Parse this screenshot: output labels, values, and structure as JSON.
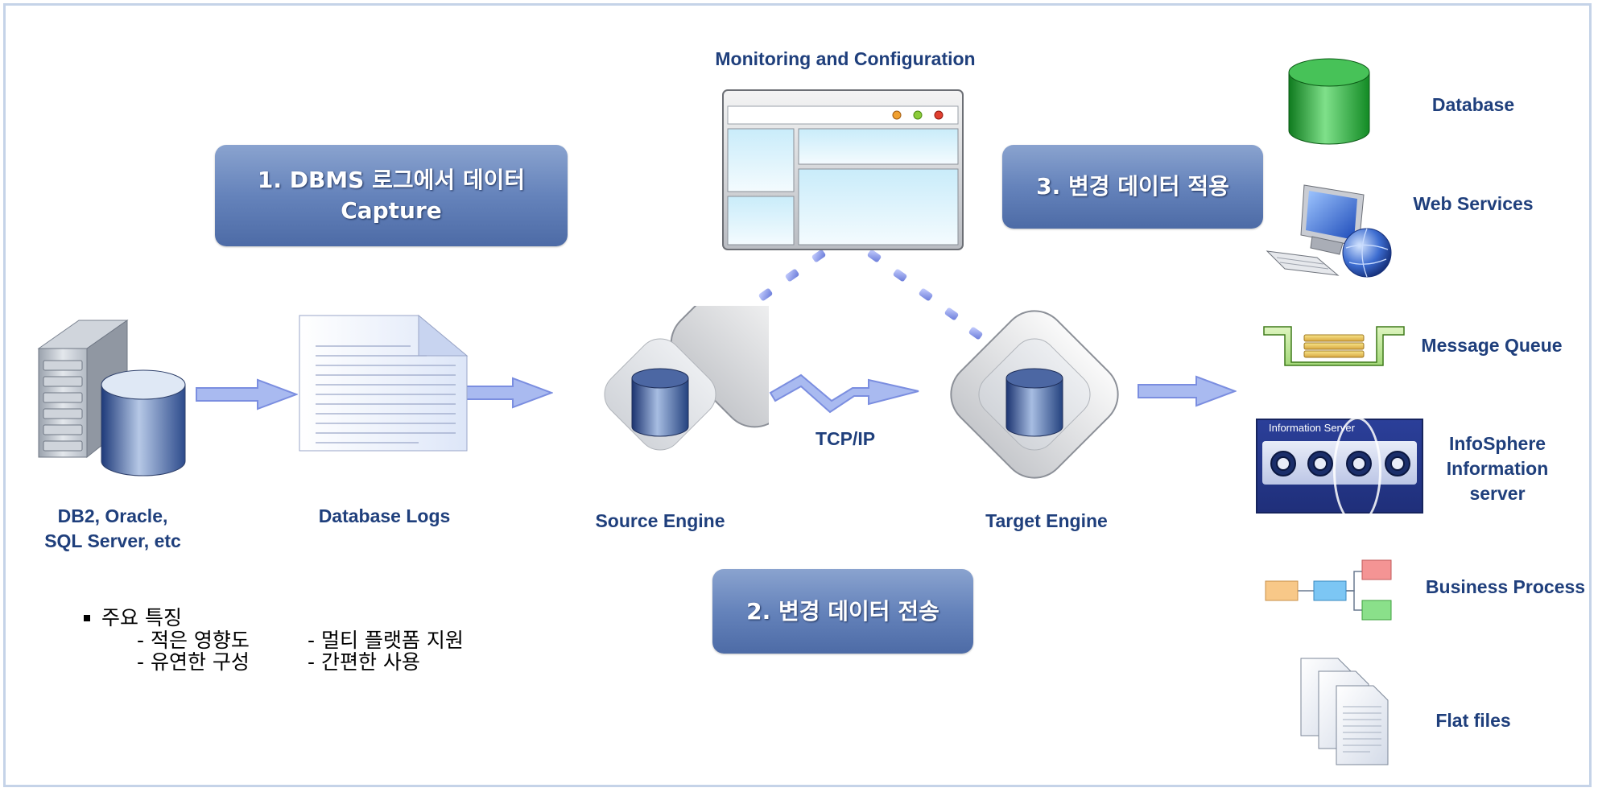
{
  "callouts": {
    "capture": "1. DBMS 로그에서 데이터\nCapture",
    "transfer": "2. 변경 데이터 전송",
    "apply": "3. 변경 데이터 적용"
  },
  "labels": {
    "monitoring": "Monitoring and Configuration",
    "sources": "DB2, Oracle,\nSQL Server, etc",
    "database_logs": "Database Logs",
    "source_engine": "Source Engine",
    "target_engine": "Target Engine",
    "tcpip": "TCP/IP",
    "info_server_panel": "Information Server"
  },
  "targets": [
    {
      "label": "Database",
      "icon": "database-icon"
    },
    {
      "label": "Web Services",
      "icon": "computer-globe-icon"
    },
    {
      "label": "Message Queue",
      "icon": "message-queue-icon"
    },
    {
      "label": "InfoSphere Information\nserver",
      "icon": "information-server-icon"
    },
    {
      "label": "Business Process",
      "icon": "process-flow-icon"
    },
    {
      "label": "Flat files",
      "icon": "files-icon"
    }
  ],
  "features": {
    "title": "주요 특징",
    "left": [
      "- 적은 영향도",
      "- 유연한 구성"
    ],
    "right": [
      "- 멀티 플랫폼 지원",
      "- 간편한 사용"
    ]
  },
  "colors": {
    "label_text": "#1f3f7c",
    "callout_fill": "#6583bb",
    "arrow_fill": "#8fa5e8",
    "connector_dots": "#7b8ee0"
  }
}
